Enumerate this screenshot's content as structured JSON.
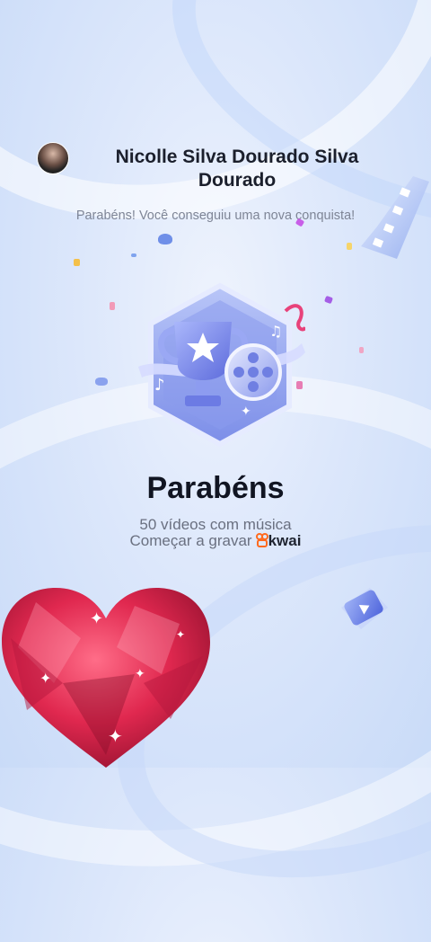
{
  "header": {
    "username": "Nicolle Silva Dourado Silva Dourado",
    "subtitle": "Parabéns! Você conseguiu uma nova conquista!"
  },
  "achievement": {
    "title": "Parabéns",
    "description": "50 vídeos com música",
    "cta_text": "Começar a gravar",
    "brand": "kwai"
  },
  "colors": {
    "accent": "#6f82e8",
    "brand_orange": "#ff6a1f",
    "heart_red": "#e0284f"
  },
  "icons": [
    "avatar",
    "trophy-icon",
    "film-reel-icon",
    "film-strip-icon",
    "play-card-icon",
    "heart-sticker"
  ]
}
